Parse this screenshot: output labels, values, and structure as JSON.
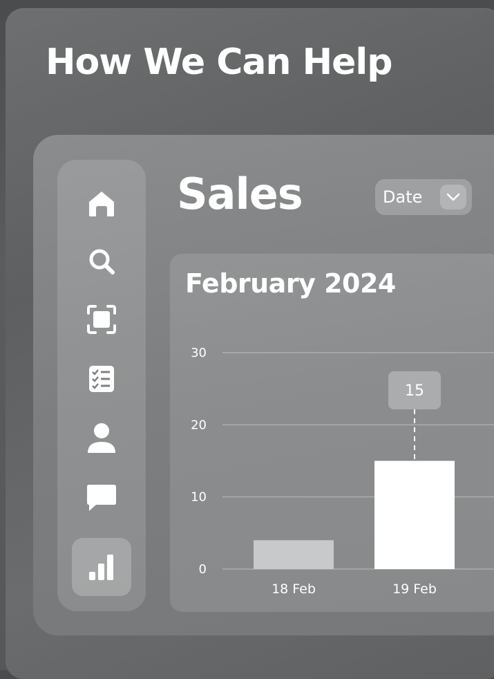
{
  "header": {
    "title": "How We Can Help"
  },
  "sidebar": {
    "items": [
      {
        "icon": "home-icon",
        "active": false
      },
      {
        "icon": "search-icon",
        "active": false
      },
      {
        "icon": "scan-icon",
        "active": false
      },
      {
        "icon": "checklist-icon",
        "active": false
      },
      {
        "icon": "user-icon",
        "active": false
      },
      {
        "icon": "chat-icon",
        "active": false
      },
      {
        "icon": "bar-chart-icon",
        "active": true
      }
    ]
  },
  "main": {
    "title": "Sales",
    "filter": {
      "label": "Date",
      "icon": "chevron-down-icon"
    }
  },
  "chart_data": {
    "type": "bar",
    "title": "February 2024",
    "categories": [
      "18 Feb",
      "19 Feb"
    ],
    "values": [
      4,
      15
    ],
    "highlighted_index": 1,
    "data_label": "15",
    "ylim": [
      0,
      30
    ],
    "yticks": [
      0,
      10,
      20,
      30
    ],
    "grid": true,
    "colors": {
      "bar": "#c8c9ca",
      "highlight": "#ffffff"
    }
  }
}
